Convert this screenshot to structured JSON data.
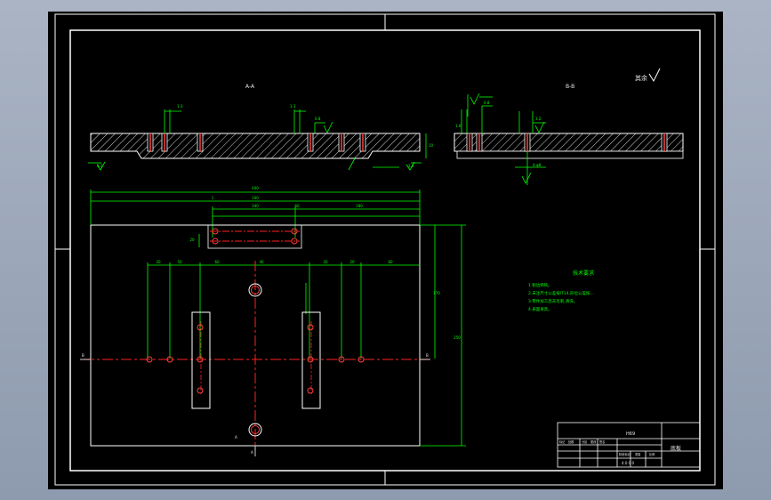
{
  "drawing": {
    "title_block": {
      "drawing_name": "底板",
      "part_code": "H69",
      "scale_row": "4.0 0 0",
      "small_left": [
        "标记",
        "处数",
        "分区",
        "更改",
        "签名"
      ],
      "small_right": [
        "阶段标记",
        "重量",
        "比例"
      ]
    },
    "section_labels": [
      "A-A",
      "B-B"
    ],
    "roughness_note": "其余",
    "technical_requirements": {
      "title": "技术要求",
      "lines": [
        "1.锐边倒钝。",
        "2.未注尺寸公差按IT14,形位公差按...",
        "3.零件加工后去毛刺,清洗。",
        "4.表面发黑。"
      ]
    },
    "colors": {
      "border": "#ffffff",
      "dimension": "#00ff00",
      "outline": "#ffffff",
      "centerline": "#ff2020",
      "hole": "#ff4040",
      "hatch": "#ffffff"
    }
  }
}
